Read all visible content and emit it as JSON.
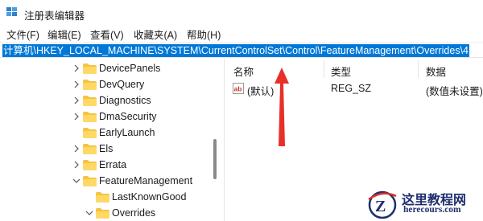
{
  "window": {
    "title": "注册表编辑器",
    "icon": "registry-editor-icon"
  },
  "menu": {
    "items": [
      {
        "label": "文件(F)"
      },
      {
        "label": "编辑(E)"
      },
      {
        "label": "查看(V)"
      },
      {
        "label": "收藏夹(A)"
      },
      {
        "label": "帮助(H)"
      }
    ]
  },
  "address": {
    "path": "计算机\\HKEY_LOCAL_MACHINE\\SYSTEM\\CurrentControlSet\\Control\\FeatureManagement\\Overrides\\4",
    "selected": true
  },
  "tree": {
    "items": [
      {
        "label": "DevicePanels",
        "expander": "collapsed"
      },
      {
        "label": "DevQuery",
        "expander": "collapsed"
      },
      {
        "label": "Diagnostics",
        "expander": "collapsed"
      },
      {
        "label": "DmaSecurity",
        "expander": "collapsed"
      },
      {
        "label": "EarlyLaunch",
        "expander": "none"
      },
      {
        "label": "Els",
        "expander": "collapsed"
      },
      {
        "label": "Errata",
        "expander": "collapsed"
      },
      {
        "label": "FeatureManagement",
        "expander": "expanded"
      },
      {
        "label": "LastKnownGood",
        "expander": "none"
      },
      {
        "label": "Overrides",
        "expander": "expanded"
      }
    ]
  },
  "list": {
    "columns": [
      "名称",
      "类型",
      "数据"
    ],
    "rows": [
      {
        "name": "(默认)",
        "type": "REG_SZ",
        "data": "(数值未设置)",
        "icon": "string-value-icon"
      }
    ]
  },
  "annotation": {
    "arrow_color": "#e8302a",
    "points_to": "address-bar"
  },
  "watermark": {
    "title": "这里教程网",
    "url": "herecours.com",
    "logo_letter": "Z"
  },
  "colors": {
    "accent": "#0078d7",
    "folder": "#f6c343",
    "arrow": "#e8302a",
    "watermark": "#1f2f6e"
  }
}
